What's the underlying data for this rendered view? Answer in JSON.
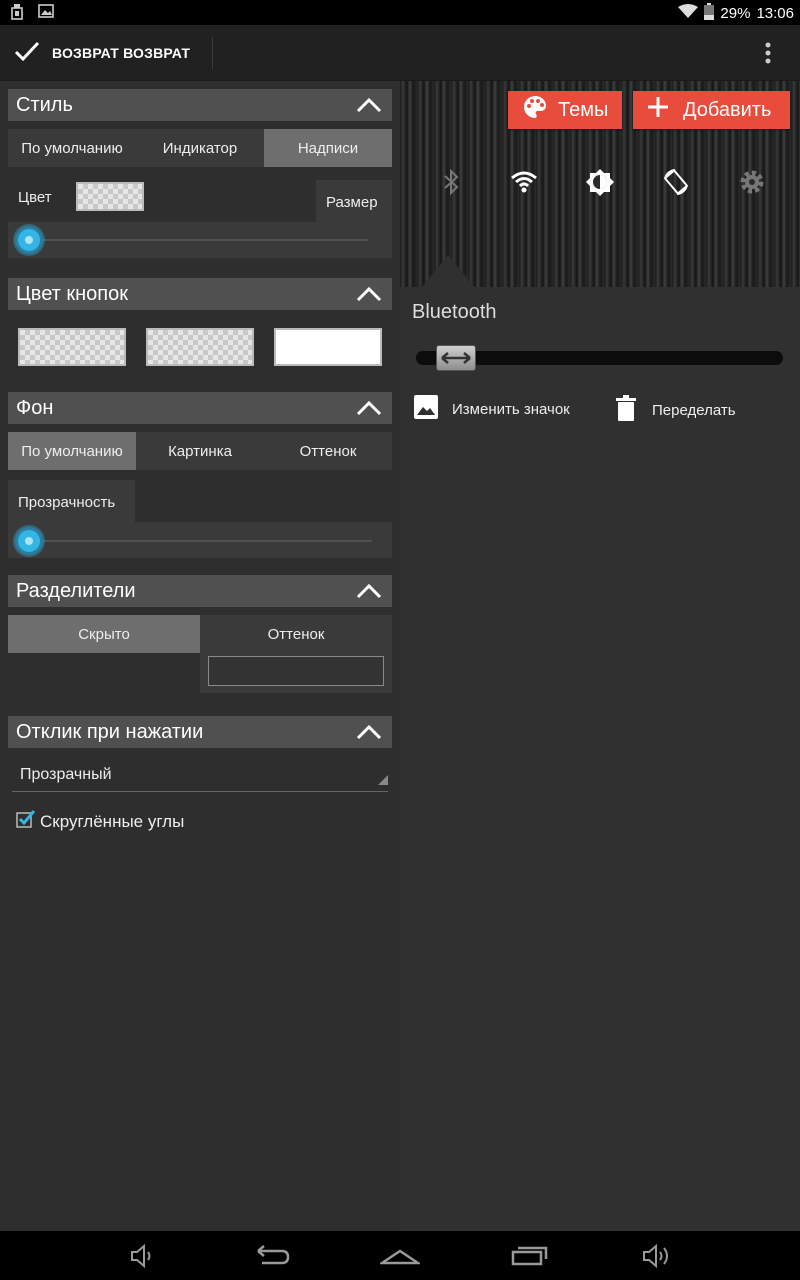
{
  "status_bar": {
    "battery": "29%",
    "time": "13:06",
    "icons": [
      "usb-icon",
      "image-icon",
      "wifi-icon",
      "battery-icon"
    ]
  },
  "action_bar": {
    "done_label": "ВОЗВРАТ ВОЗВРАТ",
    "icons": [
      "check-icon",
      "overflow-menu-icon"
    ]
  },
  "style_section": {
    "title": "Стиль",
    "tabs": [
      {
        "label": "По умолчанию",
        "active": false
      },
      {
        "label": "Индикатор",
        "active": false
      },
      {
        "label": "Надписи",
        "active": true
      }
    ],
    "color_label": "Цвет",
    "size_label": "Размер",
    "size_value": 0
  },
  "button_color_section": {
    "title": "Цвет кнопок",
    "swatches": [
      "transparent",
      "transparent",
      "#FFFFFF"
    ]
  },
  "background_section": {
    "title": "Фон",
    "tabs": [
      {
        "label": "По умолчанию",
        "active": true
      },
      {
        "label": "Картинка",
        "active": false
      },
      {
        "label": "Оттенок",
        "active": false
      }
    ],
    "transparency_label": "Прозрачность",
    "transparency_value": 0
  },
  "dividers_section": {
    "title": "Разделители",
    "options": [
      {
        "label": "Скрыто",
        "active": true
      },
      {
        "label": "Оттенок",
        "active": false
      }
    ]
  },
  "touch_feedback_section": {
    "title": "Отклик при нажатии",
    "selected": "Прозрачный",
    "rounded_corners_label": "Скруглённые углы",
    "rounded_corners_checked": true
  },
  "preview": {
    "themes_button": "Темы",
    "add_button": "Добавить",
    "tiles": [
      "bluetooth-icon",
      "wifi-icon",
      "brightness-icon",
      "auto-rotate-icon",
      "settings-icon"
    ]
  },
  "tile_editor": {
    "title": "Bluetooth",
    "change_icon_label": "Изменить значок",
    "reset_label": "Переделать"
  },
  "colors": {
    "accent": "#E84C3D",
    "slider": "#33B5E5",
    "header_bg": "#505050"
  }
}
